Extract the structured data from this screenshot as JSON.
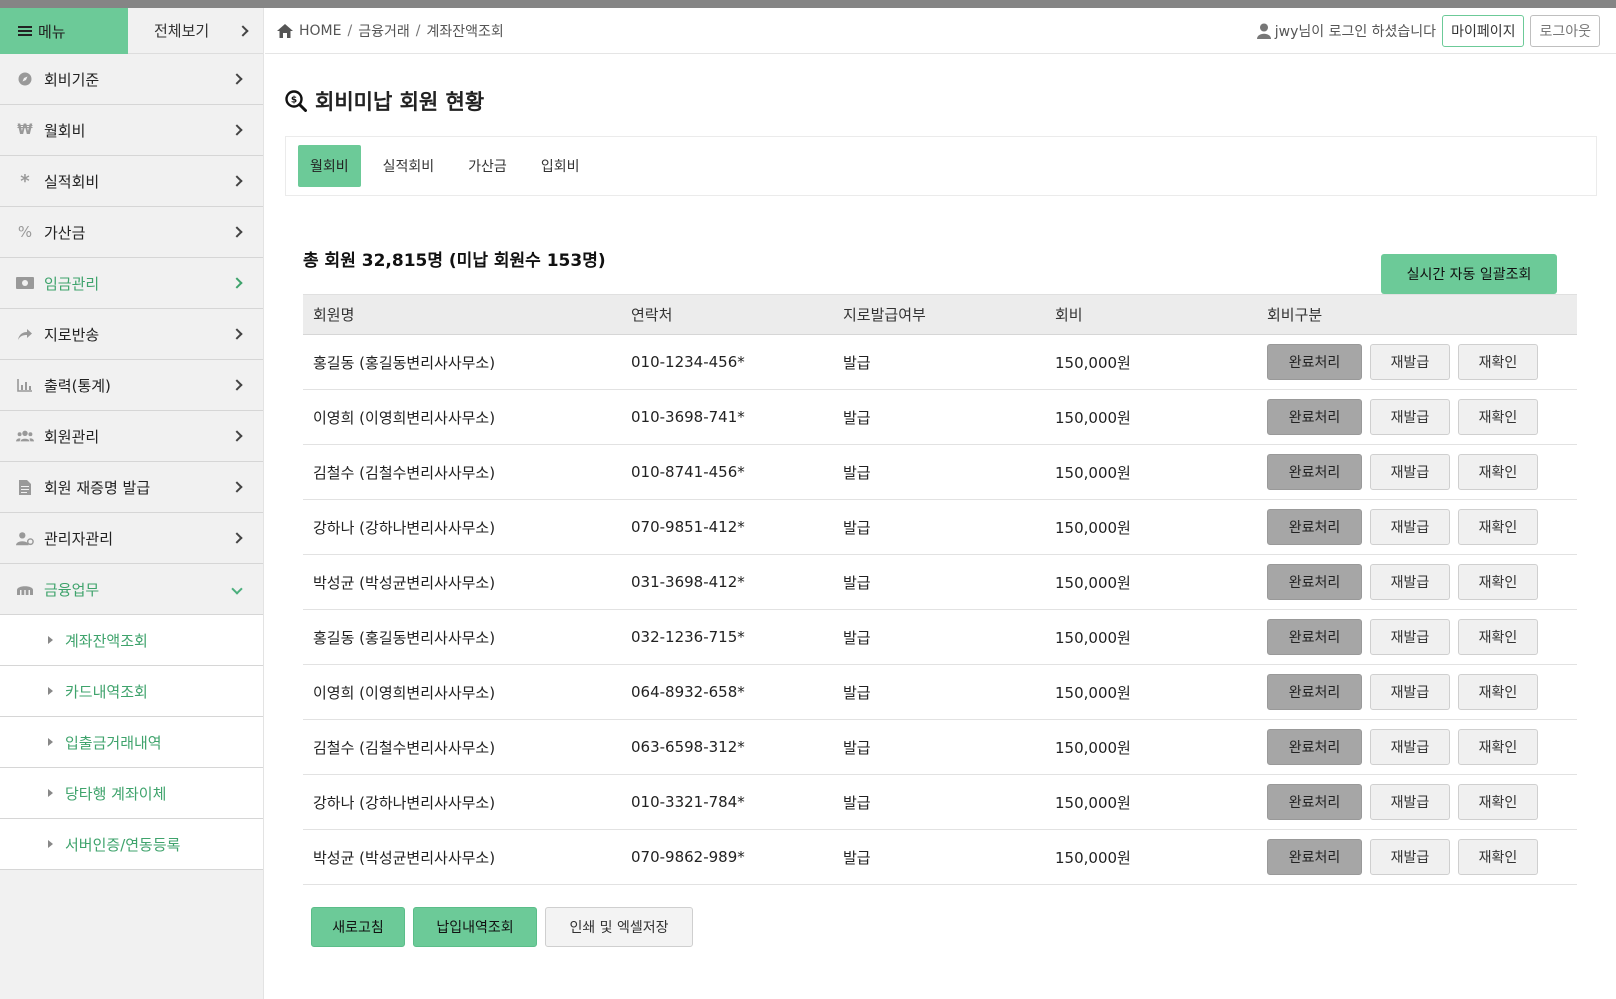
{
  "sidebar": {
    "menu_label": "메뉴",
    "view_all_label": "전체보기",
    "items": [
      {
        "label": "회비기준",
        "icon": "compass-icon"
      },
      {
        "label": "월회비",
        "icon": "won-icon"
      },
      {
        "label": "실적회비",
        "icon": "asterisk-icon"
      },
      {
        "label": "가산금",
        "icon": "percent-icon"
      },
      {
        "label": "임금관리",
        "icon": "money-icon"
      },
      {
        "label": "지로반송",
        "icon": "share-icon"
      },
      {
        "label": "출력(통계)",
        "icon": "chart-icon"
      },
      {
        "label": "회원관리",
        "icon": "users-icon"
      },
      {
        "label": "회원 재증명 발급",
        "icon": "document-icon"
      },
      {
        "label": "관리자관리",
        "icon": "user-cog-icon"
      },
      {
        "label": "금융업무",
        "icon": "bank-icon"
      }
    ],
    "sub_items": [
      "계좌잔액조회",
      "카드내역조회",
      "입출금거래내역",
      "당타행 계좌이체",
      "서버인증/연동등록"
    ]
  },
  "header": {
    "breadcrumb": [
      "HOME",
      "금융거래",
      "계좌잔액조회"
    ],
    "user_text": "jwy님이 로그인 하셨습니다",
    "mypage_label": "마이페이지",
    "logout_label": "로그아웃"
  },
  "main": {
    "title": "회비미납 회원 현황",
    "tabs": [
      "월회비",
      "실적회비",
      "가산금",
      "입회비"
    ],
    "summary": "총 회원 32,815명 (미납 회원수 153명)",
    "auto_button": "실시간 자동 일괄조회",
    "columns": [
      "회원명",
      "연락처",
      "지로발급여부",
      "회비",
      "회비구분"
    ],
    "rows": [
      {
        "name": "홍길동 (홍길동변리사사무소)",
        "phone": "010-1234-456*",
        "giro": "발급",
        "fee": "150,000원"
      },
      {
        "name": "이영희 (이영희변리사사무소)",
        "phone": "010-3698-741*",
        "giro": "발급",
        "fee": "150,000원"
      },
      {
        "name": "김철수 (김철수변리사사무소)",
        "phone": "010-8741-456*",
        "giro": "발급",
        "fee": "150,000원"
      },
      {
        "name": "강하나 (강하나변리사사무소)",
        "phone": "070-9851-412*",
        "giro": "발급",
        "fee": "150,000원"
      },
      {
        "name": "박성균 (박성균변리사사무소)",
        "phone": "031-3698-412*",
        "giro": "발급",
        "fee": "150,000원"
      },
      {
        "name": "홍길동 (홍길동변리사사무소)",
        "phone": "032-1236-715*",
        "giro": "발급",
        "fee": "150,000원"
      },
      {
        "name": "이영희 (이영희변리사사무소)",
        "phone": "064-8932-658*",
        "giro": "발급",
        "fee": "150,000원"
      },
      {
        "name": "김철수 (김철수변리사사무소)",
        "phone": "063-6598-312*",
        "giro": "발급",
        "fee": "150,000원"
      },
      {
        "name": "강하나 (강하나변리사사무소)",
        "phone": "010-3321-784*",
        "giro": "발급",
        "fee": "150,000원"
      },
      {
        "name": "박성균 (박성균변리사사무소)",
        "phone": "070-9862-989*",
        "giro": "발급",
        "fee": "150,000원"
      }
    ],
    "row_actions": {
      "complete": "완료처리",
      "reissue": "재발급",
      "recheck": "재확인"
    },
    "bottom_buttons": {
      "refresh": "새로고침",
      "payment_history": "납입내역조회",
      "print_excel": "인쇄 및 엑셀저장"
    }
  },
  "colors": {
    "accent": "#6cca98",
    "accent_text": "#3fa36c",
    "gray_button": "#a6a6a6"
  }
}
